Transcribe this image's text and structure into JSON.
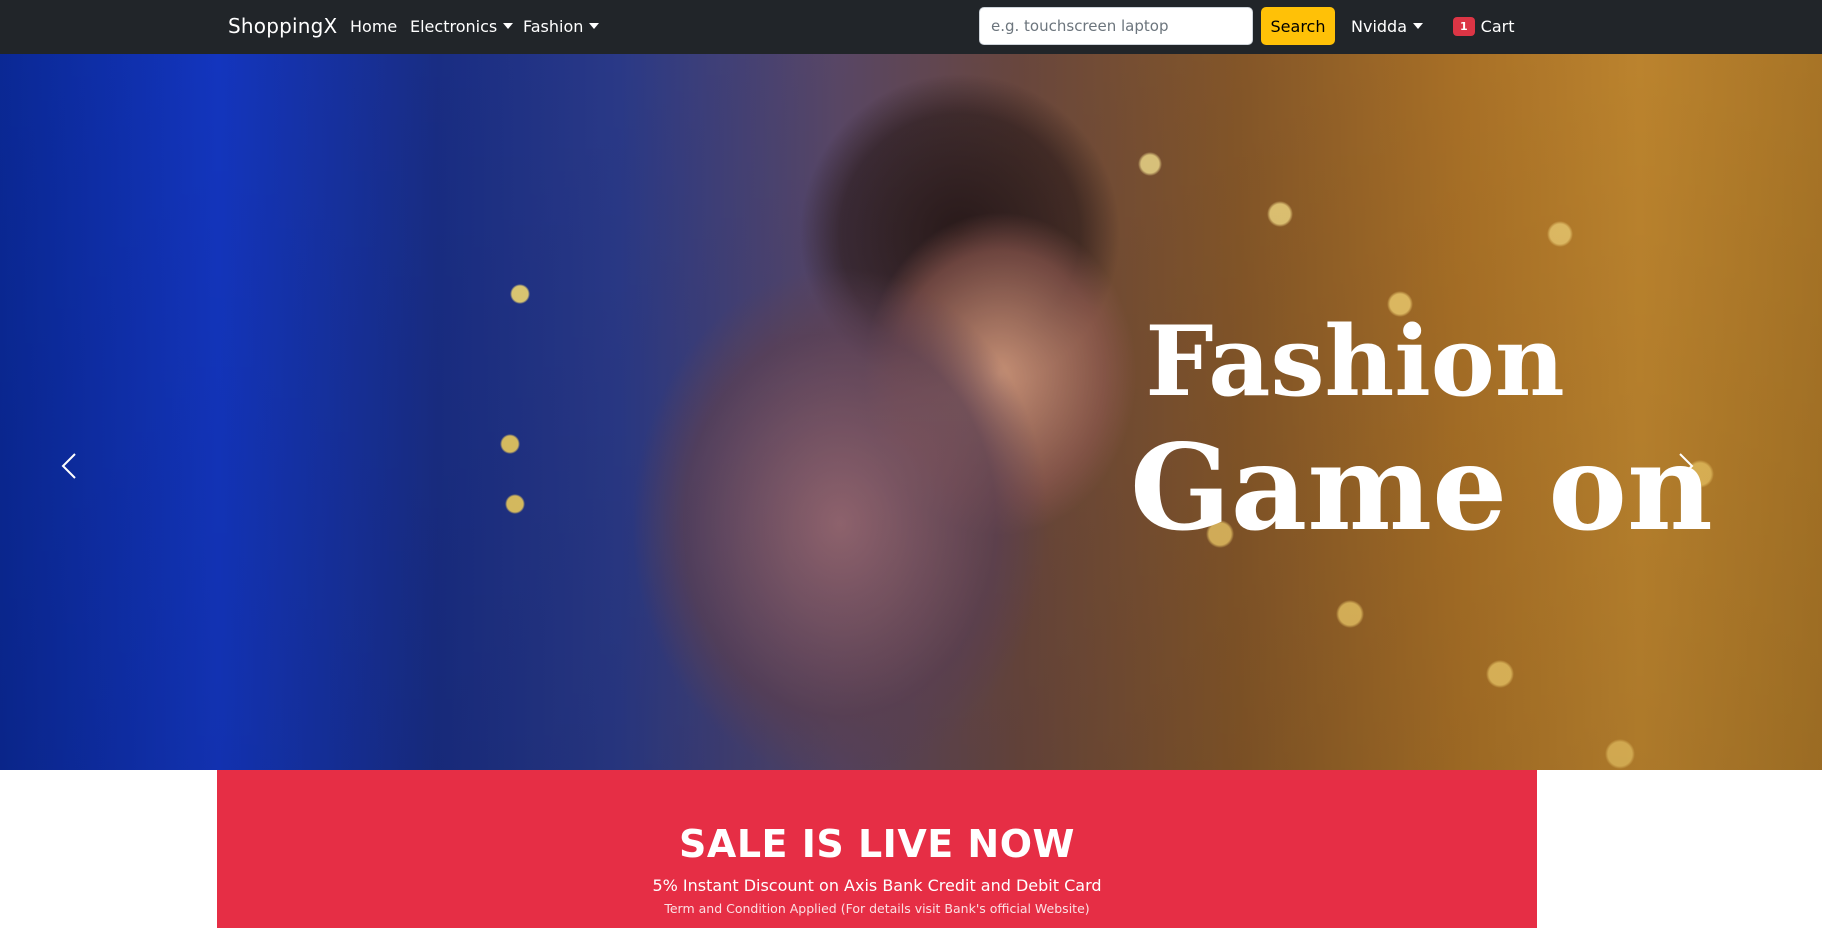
{
  "navbar": {
    "brand": "ShoppingX",
    "links": [
      {
        "label": "Home"
      },
      {
        "label": "Electronics"
      },
      {
        "label": "Fashion"
      }
    ],
    "search": {
      "placeholder": "e.g. touchscreen laptop",
      "value": "",
      "button_label": "Search"
    },
    "user_menu": "Nvidda",
    "cart": {
      "count": "1",
      "label": "Cart"
    },
    "colors": {
      "background": "#212529",
      "search_button": "#ffc107",
      "badge": "#dc3545"
    }
  },
  "hero": {
    "line1": "Fashion",
    "line2": "Game on",
    "prev_icon": "chevron-left-icon",
    "next_icon": "chevron-right-icon"
  },
  "sale_banner": {
    "title": "SALE IS LIVE NOW",
    "subtitle": "5% Instant Discount on Axis Bank Credit and Debit Card",
    "note": "Term and Condition Applied (For details visit Bank's official Website)",
    "background": "#e62e45"
  }
}
